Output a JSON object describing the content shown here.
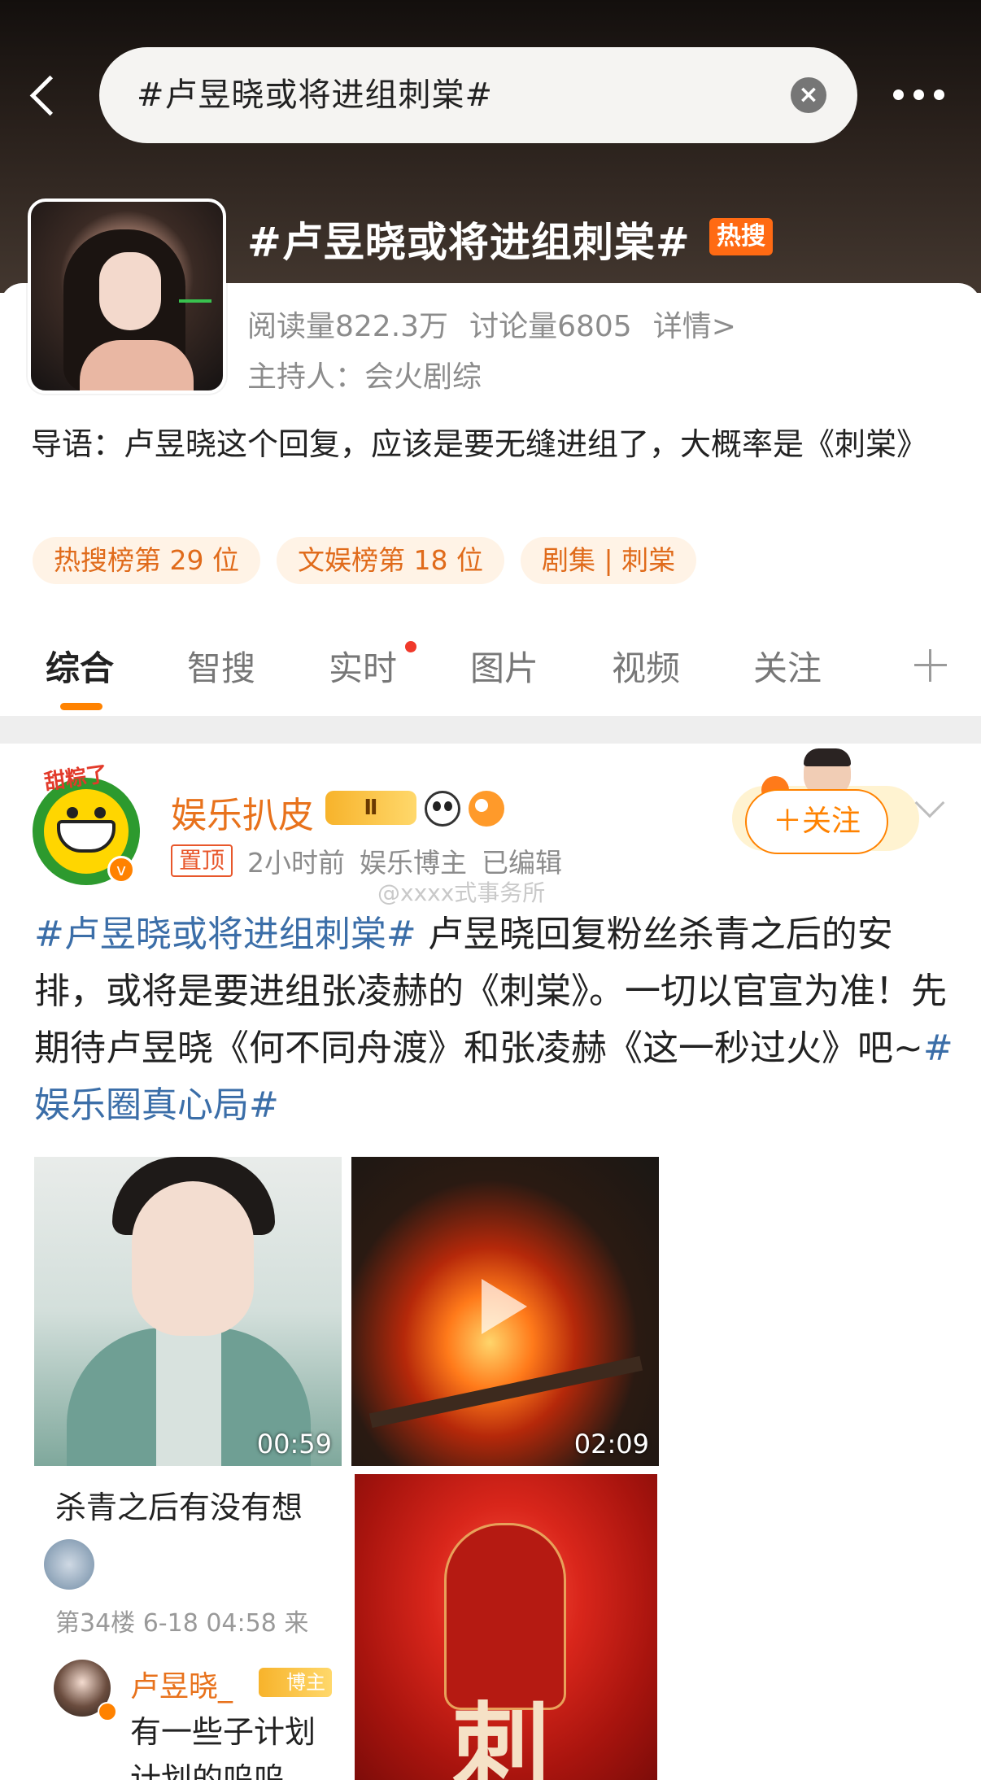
{
  "search": {
    "query": "#卢昱晓或将进组刺棠#"
  },
  "topic": {
    "title": "#卢昱晓或将进组刺棠#",
    "hot_badge": "热搜",
    "reads": "阅读量822.3万",
    "discussions": "讨论量6805",
    "details_link": "详情>",
    "host": "主持人：会火剧综",
    "intro": "导语：卢昱晓这个回复，应该是要无缝进组了，大概率是《刺棠》",
    "tags": [
      "热搜榜第 29 位",
      "文娱榜第 18 位",
      "剧集 | 刺棠"
    ]
  },
  "tabs": [
    "综合",
    "智搜",
    "实时",
    "图片",
    "视频",
    "关注"
  ],
  "post": {
    "avatar_label": "甜粽了",
    "username": "娱乐扒皮",
    "level_badge": "Ⅱ",
    "pin": "置顶",
    "time": "2小时前",
    "role": "娱乐博主",
    "edited": "已编辑",
    "watermark": "@xxxx式事务所",
    "follow_label": "＋关注",
    "text_hashtag1": "#卢昱晓或将进组刺棠#",
    "text_body": " 卢昱晓回复粉丝杀青之后的安排，或将是要进组张凌赫的《刺棠》。一切以官宣为准！先期待卢昱晓《何不同舟渡》和张凌赫《这一秒过火》吧~",
    "text_hashtag2": "#娱乐圈真心局#",
    "media": {
      "video1_duration": "00:59",
      "video2_duration": "02:09",
      "comment_quote": "杀青之后有没有想",
      "comment_floor": "第34楼 6-18 04:58 来",
      "reply_name": "卢昱晓_",
      "reply_badge": "博主",
      "reply_text": "有一些子计划 计划的呜呜",
      "poster_char": "刺"
    }
  },
  "colors": {
    "accent": "#ff8200",
    "hashtag": "#3b6ea8",
    "hot": "#ff6a13"
  }
}
